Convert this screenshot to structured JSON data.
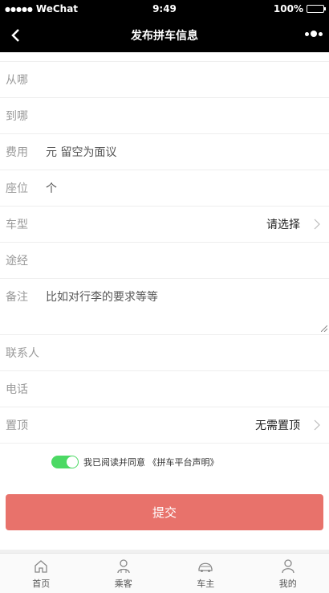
{
  "status_bar": {
    "signal_dots": "●●●●●",
    "carrier": "WeChat",
    "time": "9:49",
    "battery_percent": "100%",
    "battery_level": 1.0
  },
  "nav": {
    "title": "发布拼车信息",
    "back_icon": "chevron-left-icon",
    "more_icon": "more-dots-icon"
  },
  "form": {
    "from": {
      "label": "从哪",
      "value": ""
    },
    "to": {
      "label": "到哪",
      "value": ""
    },
    "fee": {
      "label": "费用",
      "value": "元 留空为面议"
    },
    "seats": {
      "label": "座位",
      "value": "个"
    },
    "car_type": {
      "label": "车型",
      "value": "请选择"
    },
    "via": {
      "label": "途经",
      "value": ""
    },
    "remark": {
      "label": "备注",
      "value": "比如对行李的要求等等"
    },
    "contact": {
      "label": "联系人",
      "value": ""
    },
    "phone": {
      "label": "电话",
      "value": ""
    },
    "pin_top": {
      "label": "置顶",
      "value": "无需置顶"
    }
  },
  "agreement": {
    "checked": true,
    "text": "我已阅读并同意 《拼车平台声明》",
    "accent_color": "#4cd964"
  },
  "submit": {
    "label": "提交",
    "color": "#e8726b"
  },
  "tabbar": {
    "items": [
      {
        "label": "首页",
        "icon": "home-icon"
      },
      {
        "label": "乘客",
        "icon": "passenger-icon"
      },
      {
        "label": "车主",
        "icon": "car-icon"
      },
      {
        "label": "我的",
        "icon": "profile-icon"
      }
    ]
  }
}
